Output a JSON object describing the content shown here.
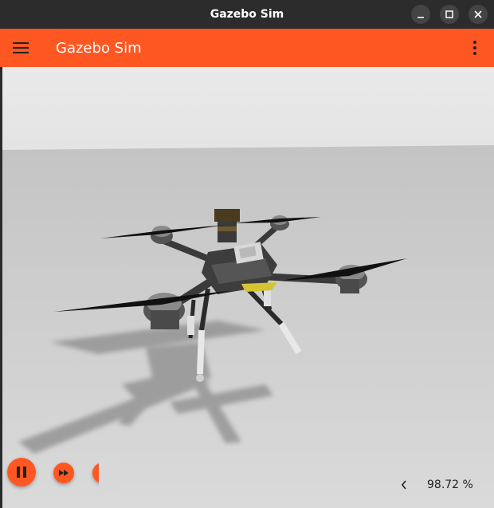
{
  "window": {
    "title": "Gazebo Sim"
  },
  "appbar": {
    "title": "Gazebo Sim",
    "color": "#ff5722"
  },
  "scene": {
    "description_icon": "drone-3d-model"
  },
  "playback": {
    "pause_icon": "pause-icon",
    "step_icon": "fast-forward-icon"
  },
  "stats": {
    "real_time_factor": "98.72 %"
  }
}
